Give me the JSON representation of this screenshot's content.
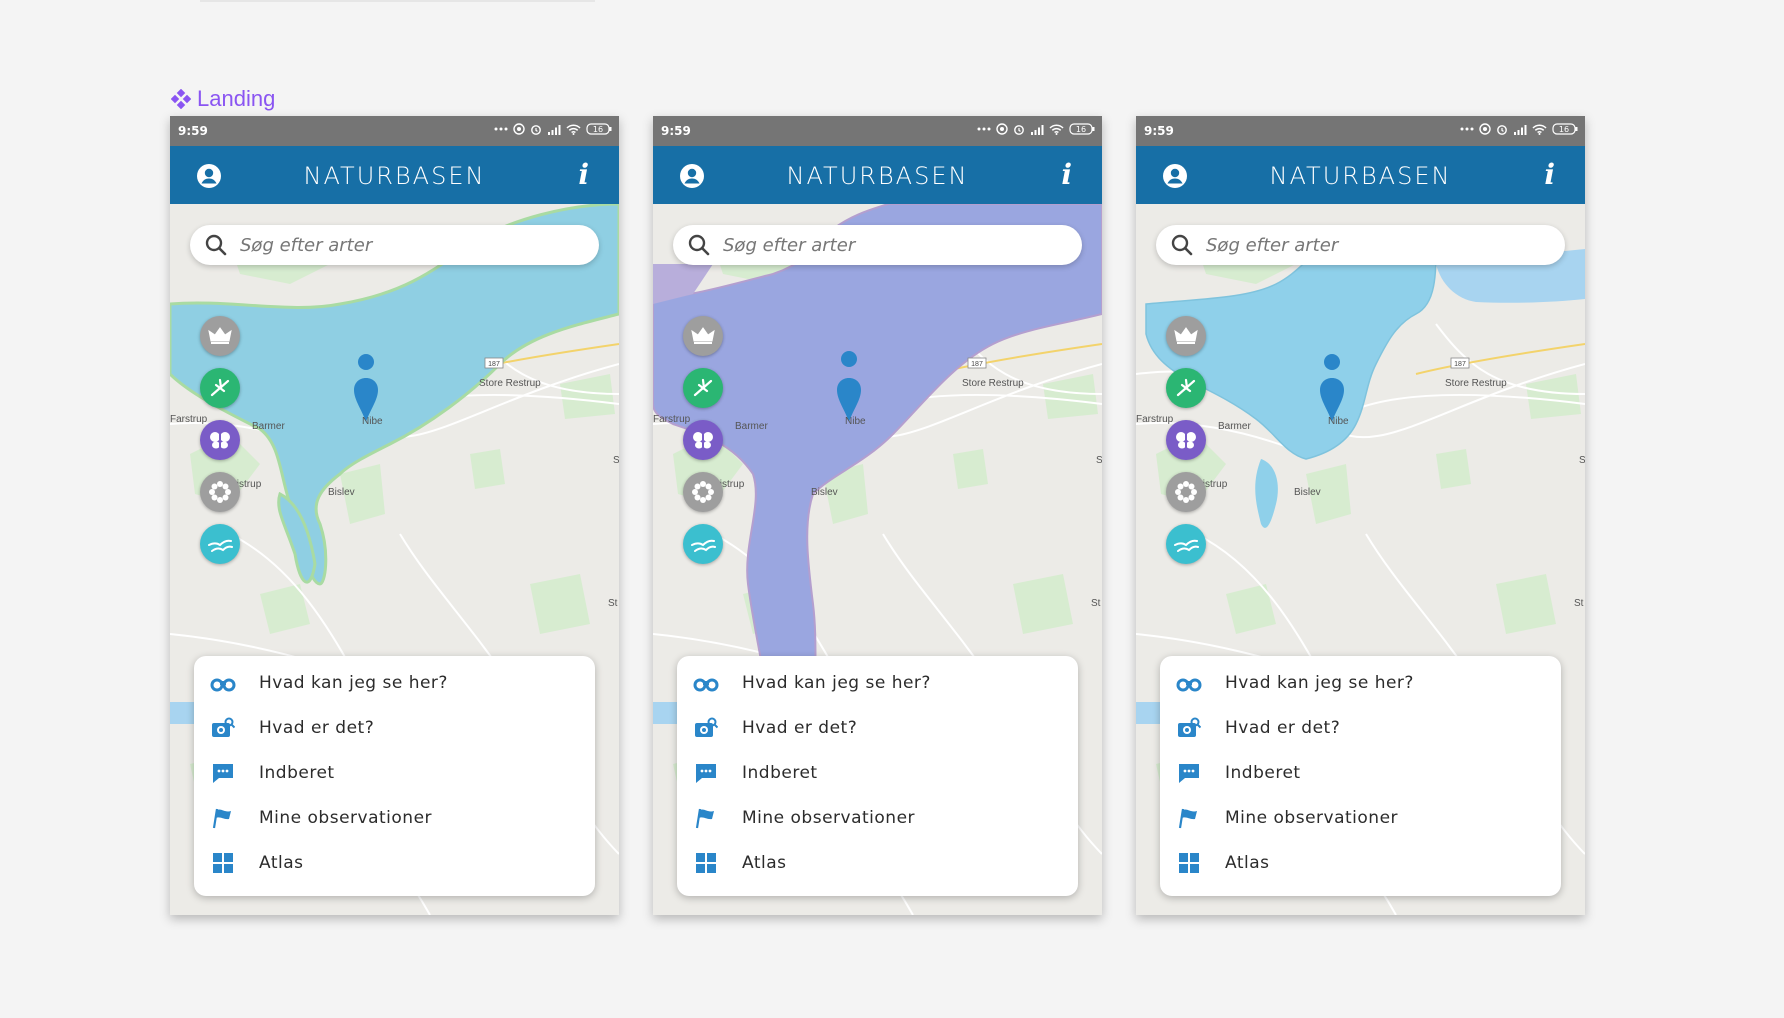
{
  "frame": {
    "label": "Landing",
    "label_color": "#8a55f2"
  },
  "status_bar": {
    "time": "9:59",
    "battery": "16"
  },
  "app": {
    "title": "NATURBASEN",
    "info_symbol": "i",
    "accent": "#176fa6"
  },
  "search": {
    "placeholder": "Søg efter arter"
  },
  "map_labels": {
    "store_restrup": "Store Restrup",
    "road_187": "187",
    "farstrup": "Farstrup",
    "barmer": "Barmer",
    "nibe": "Nibe",
    "store_ajstrup": "Store Ajstrup",
    "bislev": "Bislev",
    "s_edge": "S",
    "st_edge": "St"
  },
  "categories": [
    {
      "name": "crown-icon",
      "color": "#9e9e9e"
    },
    {
      "name": "bird-icon",
      "color": "#2bb673"
    },
    {
      "name": "butterfly-icon",
      "color": "#7a5cc7"
    },
    {
      "name": "flower-icon",
      "color": "#9e9e9e"
    },
    {
      "name": "flying-bird-icon",
      "color": "#3bbfcf"
    }
  ],
  "menu": {
    "items": [
      {
        "label": "Hvad kan jeg se her?",
        "icon": "binoculars-icon"
      },
      {
        "label": "Hvad er det?",
        "icon": "camera-search-icon"
      },
      {
        "label": "Indberet",
        "icon": "message-icon"
      },
      {
        "label": "Mine observationer",
        "icon": "flag-icon"
      },
      {
        "label": "Atlas",
        "icon": "grid-icon"
      }
    ]
  },
  "phones": [
    {
      "variant": "green-outline",
      "overlay_color": "#8fcfe3"
    },
    {
      "variant": "purple-overlay",
      "overlay_color": "#9aa6e0"
    },
    {
      "variant": "blue-region",
      "overlay_color": "#8fd0ea"
    }
  ]
}
